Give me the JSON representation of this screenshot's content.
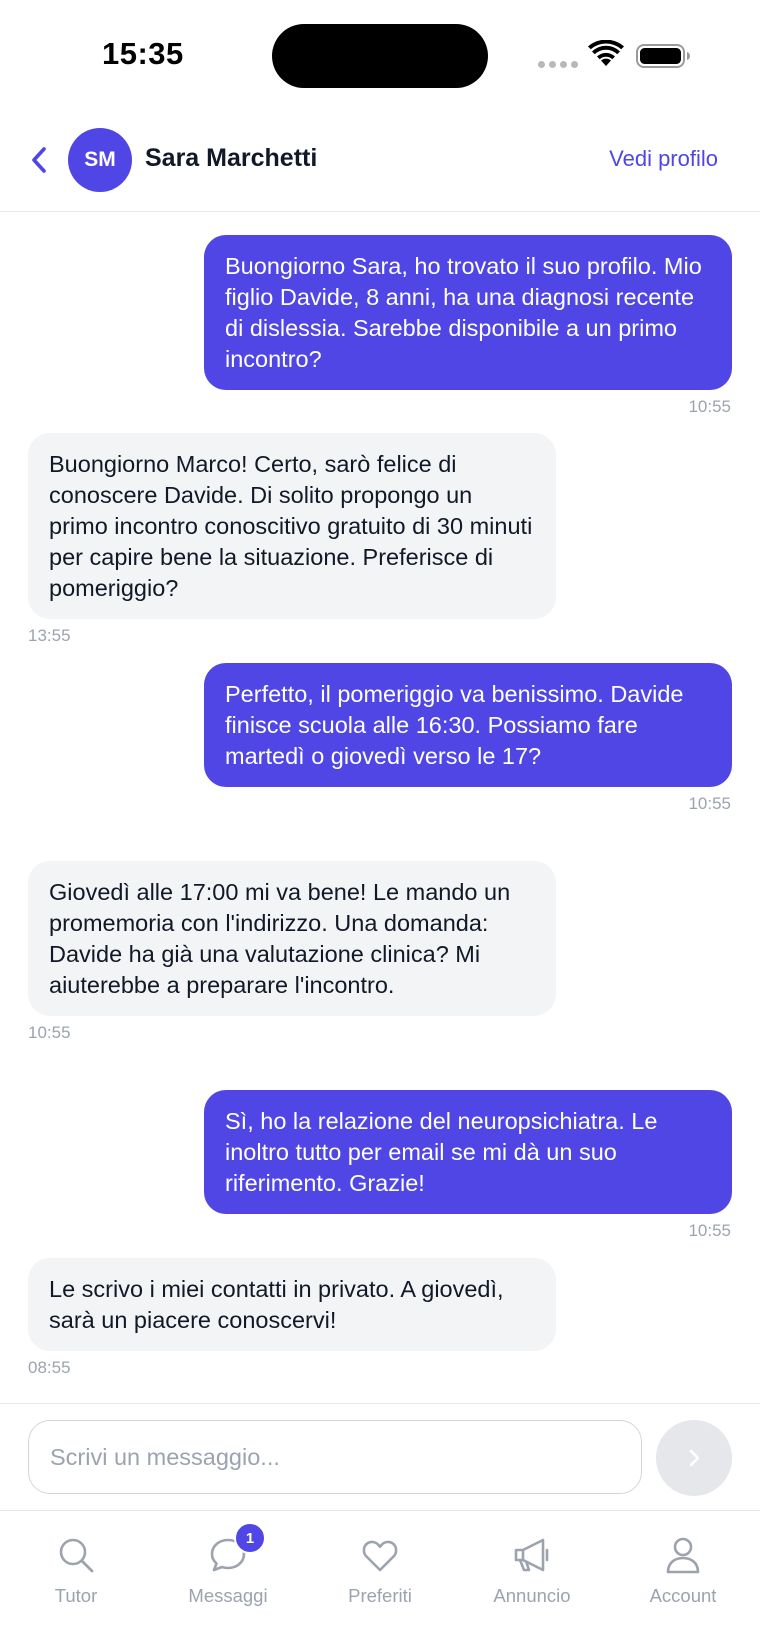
{
  "status_bar": {
    "time": "15:35"
  },
  "header": {
    "back_icon": "chevron-left-icon",
    "avatar_initials": "SM",
    "contact_name": "Sara Marchetti",
    "view_profile_label": "Vedi profilo"
  },
  "messages": [
    {
      "direction": "out",
      "text": "Buongiorno Sara, ho trovato il suo profilo. Mio figlio Davide, 8 anni, ha una diagnosi recente di dislessia. Sarebbe disponibile a un primo incontro?",
      "time": "10:55"
    },
    {
      "direction": "in",
      "text": "Buongiorno Marco! Certo, sarò felice di conoscere Davide. Di solito propongo un primo incontro conoscitivo gratuito di 30 minuti per capire bene la situazione. Preferisce di pomeriggio?",
      "time": "13:55"
    },
    {
      "direction": "out",
      "text": "Perfetto, il pomeriggio va benissimo. Davide finisce scuola alle 16:30. Possiamo fare martedì o giovedì verso le 17?",
      "time": "10:55"
    },
    {
      "direction": "in",
      "text": "Giovedì alle 17:00 mi va bene! Le mando un promemoria con l'indirizzo. Una domanda: Davide ha già una valutazione clinica? Mi aiuterebbe a preparare l'incontro.",
      "time": "10:55"
    },
    {
      "direction": "out",
      "text": "Sì, ho la relazione del neuropsichiatra. Le inoltro tutto per email se mi dà un suo riferimento. Grazie!",
      "time": "10:55"
    },
    {
      "direction": "in",
      "text": "Le scrivo i miei contatti in privato. A giovedì, sarà un piacere conoscervi!",
      "time": "08:55"
    }
  ],
  "composer": {
    "placeholder": "Scrivi un messaggio...",
    "value": "",
    "send_icon": "chevron-right-icon"
  },
  "tabs": [
    {
      "label": "Tutor",
      "icon": "search-icon"
    },
    {
      "label": "Messaggi",
      "icon": "chat-bubble-icon",
      "badge": "1"
    },
    {
      "label": "Preferiti",
      "icon": "heart-icon"
    },
    {
      "label": "Annuncio",
      "icon": "megaphone-icon"
    },
    {
      "label": "Account",
      "icon": "person-icon"
    }
  ],
  "colors": {
    "accent": "#4f46e5",
    "incoming_bubble": "#f3f4f6",
    "muted_text": "#9ca3af",
    "divider": "#e5e7eb"
  }
}
